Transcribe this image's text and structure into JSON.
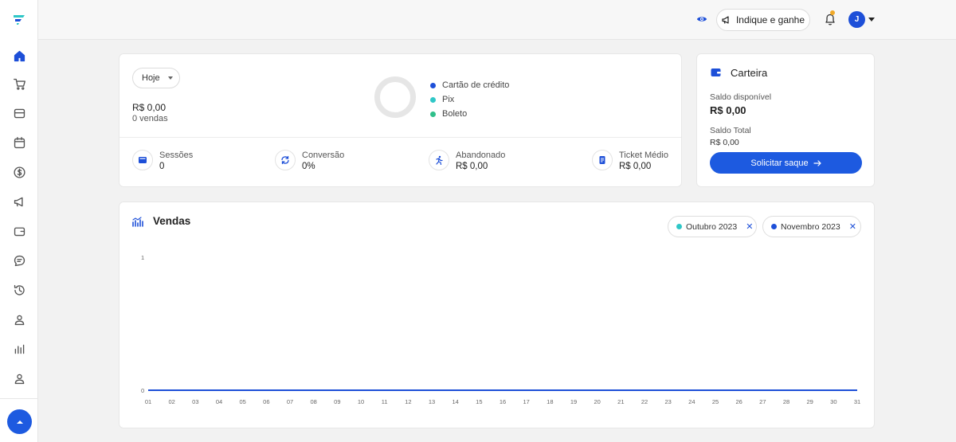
{
  "header": {
    "invite_label": "Indique e ganhe",
    "avatar_initial": "J"
  },
  "sidebar": {
    "items": [
      "home-icon",
      "cart-icon",
      "store-icon",
      "calendar-icon",
      "dollar-icon",
      "megaphone-icon",
      "wallet-icon",
      "chat-icon",
      "history-icon",
      "users-icon",
      "bar-chart-icon",
      "user-icon"
    ]
  },
  "summary": {
    "period": "Hoje",
    "amount": "R$ 0,00",
    "sales_count": "0 vendas",
    "legend": [
      {
        "label": "Cartão de crédito",
        "color": "#1d4fd8"
      },
      {
        "label": "Pix",
        "color": "#2fc7c7"
      },
      {
        "label": "Boleto",
        "color": "#2fbf8a"
      }
    ],
    "metrics": [
      {
        "label": "Sessões",
        "value": "0",
        "icon": "window-icon"
      },
      {
        "label": "Conversão",
        "value": "0%",
        "icon": "refresh-icon"
      },
      {
        "label": "Abandonado",
        "value": "R$ 0,00",
        "icon": "running-icon"
      },
      {
        "label": "Ticket Médio",
        "value": "R$ 0,00",
        "icon": "receipt-icon"
      }
    ]
  },
  "wallet": {
    "title": "Carteira",
    "available_label": "Saldo disponível",
    "available_value": "R$ 0,00",
    "total_label": "Saldo Total",
    "total_value": "R$ 0,00",
    "withdraw_label": "Solicitar saque"
  },
  "sales": {
    "title": "Vendas",
    "filters": [
      {
        "label": "Outubro 2023",
        "color": "#2fc7c7"
      },
      {
        "label": "Novembro 2023",
        "color": "#1d4fd8"
      }
    ]
  },
  "chart_data": {
    "type": "line",
    "x": [
      "01",
      "02",
      "03",
      "04",
      "05",
      "06",
      "07",
      "08",
      "09",
      "10",
      "11",
      "12",
      "13",
      "14",
      "15",
      "16",
      "17",
      "18",
      "19",
      "20",
      "21",
      "22",
      "23",
      "24",
      "25",
      "26",
      "27",
      "28",
      "29",
      "30",
      "31"
    ],
    "series": [
      {
        "name": "Outubro 2023",
        "color": "#2fc7c7",
        "values": [
          0,
          0,
          0,
          0,
          0,
          0,
          0,
          0,
          0,
          0,
          0,
          0,
          0,
          0,
          0,
          0,
          0,
          0,
          0,
          0,
          0,
          0,
          0,
          0,
          0,
          0,
          0,
          0,
          0,
          0,
          0
        ]
      },
      {
        "name": "Novembro 2023",
        "color": "#1d4fd8",
        "values": [
          0,
          0,
          0,
          0,
          0,
          0,
          0,
          0,
          0,
          0,
          0,
          0,
          0,
          0,
          0,
          0,
          0,
          0,
          0,
          0,
          0,
          0,
          0,
          0,
          0,
          0,
          0,
          0,
          0,
          0,
          0
        ]
      }
    ],
    "yticks": [
      "1",
      "0"
    ],
    "ylim": [
      0,
      1
    ],
    "grid": false
  }
}
